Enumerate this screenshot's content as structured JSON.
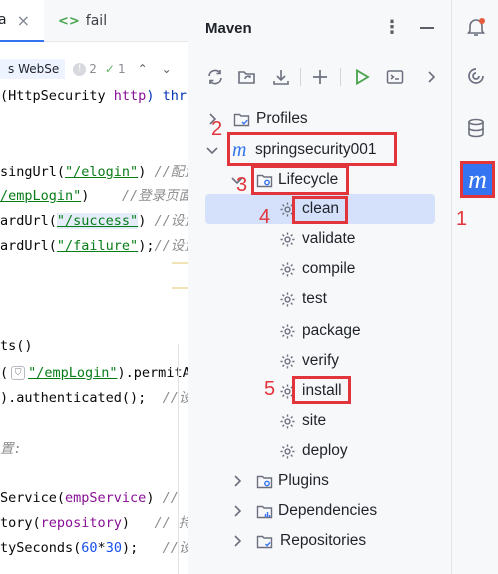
{
  "editor": {
    "tabs": [
      {
        "name": "a",
        "close": "×"
      },
      {
        "name": "fail",
        "icon": "<>"
      }
    ],
    "breadcrumb": {
      "class_name": "s WebSe",
      "warnings": "2",
      "checks": "1"
    },
    "code_lines": {
      "l1_a": "(HttpSecurity ",
      "l1_b": "http",
      "l1_c": ") thro",
      "l2_a": "singUrl(",
      "l2_b": "\"/elogin\"",
      "l2_c": ") ",
      "l2_d": "//配置",
      "l3_a": "/empLogin\"",
      "l3_b": ")    ",
      "l3_c": "//登录页面",
      "l4_a": "ardUrl(",
      "l4_b": "\"/success\"",
      "l4_c": ") ",
      "l4_d": "//设置",
      "l5_a": "ardUrl(",
      "l5_b": "\"/failure\"",
      "l5_c": ");",
      "l5_d": "//设置",
      "l6_a": "ts()",
      "l7_a": "(",
      "l7_b": "\"/empLogin\"",
      "l7_c": ").permitAl",
      "l8_a": ").authenticated();  ",
      "l8_b": "//设",
      "l9_a": "置:",
      "l10_a": "Service(",
      "l10_b": "empService",
      "l10_c": ") ",
      "l10_d": "// 設",
      "l11_a": "tory(",
      "l11_b": "repository",
      "l11_c": ")   ",
      "l11_d": "// 持",
      "l12_a": "tySeconds(",
      "l12_b": "60",
      "l12_c": "*",
      "l12_d": "30",
      "l12_e": ");   ",
      "l12_f": "//设"
    }
  },
  "maven": {
    "title": "Maven",
    "tree": {
      "profiles": "Profiles",
      "project": "springsecurity001",
      "lifecycle": "Lifecycle",
      "phases": [
        "clean",
        "validate",
        "compile",
        "test",
        "package",
        "verify",
        "install",
        "site",
        "deploy"
      ],
      "plugins": "Plugins",
      "dependencies": "Dependencies",
      "repositories": "Repositories"
    },
    "selected_phase": "clean"
  },
  "annotations": [
    "1",
    "2",
    "3",
    "4",
    "5"
  ],
  "colors": {
    "accent": "#3574f0",
    "annotation_red": "#e2343b",
    "selection": "#d5e1fb",
    "code_string": "#067d17",
    "code_comment": "#8c8c8c"
  },
  "icons": {
    "stripe": [
      "notifications-icon",
      "ai-assistant-icon",
      "database-icon",
      "maven-icon"
    ],
    "toolbar": [
      "reload-icon",
      "generate-sources-icon",
      "download-icon",
      "add-icon",
      "run-icon",
      "execute-goal-icon",
      "more-icon"
    ]
  }
}
